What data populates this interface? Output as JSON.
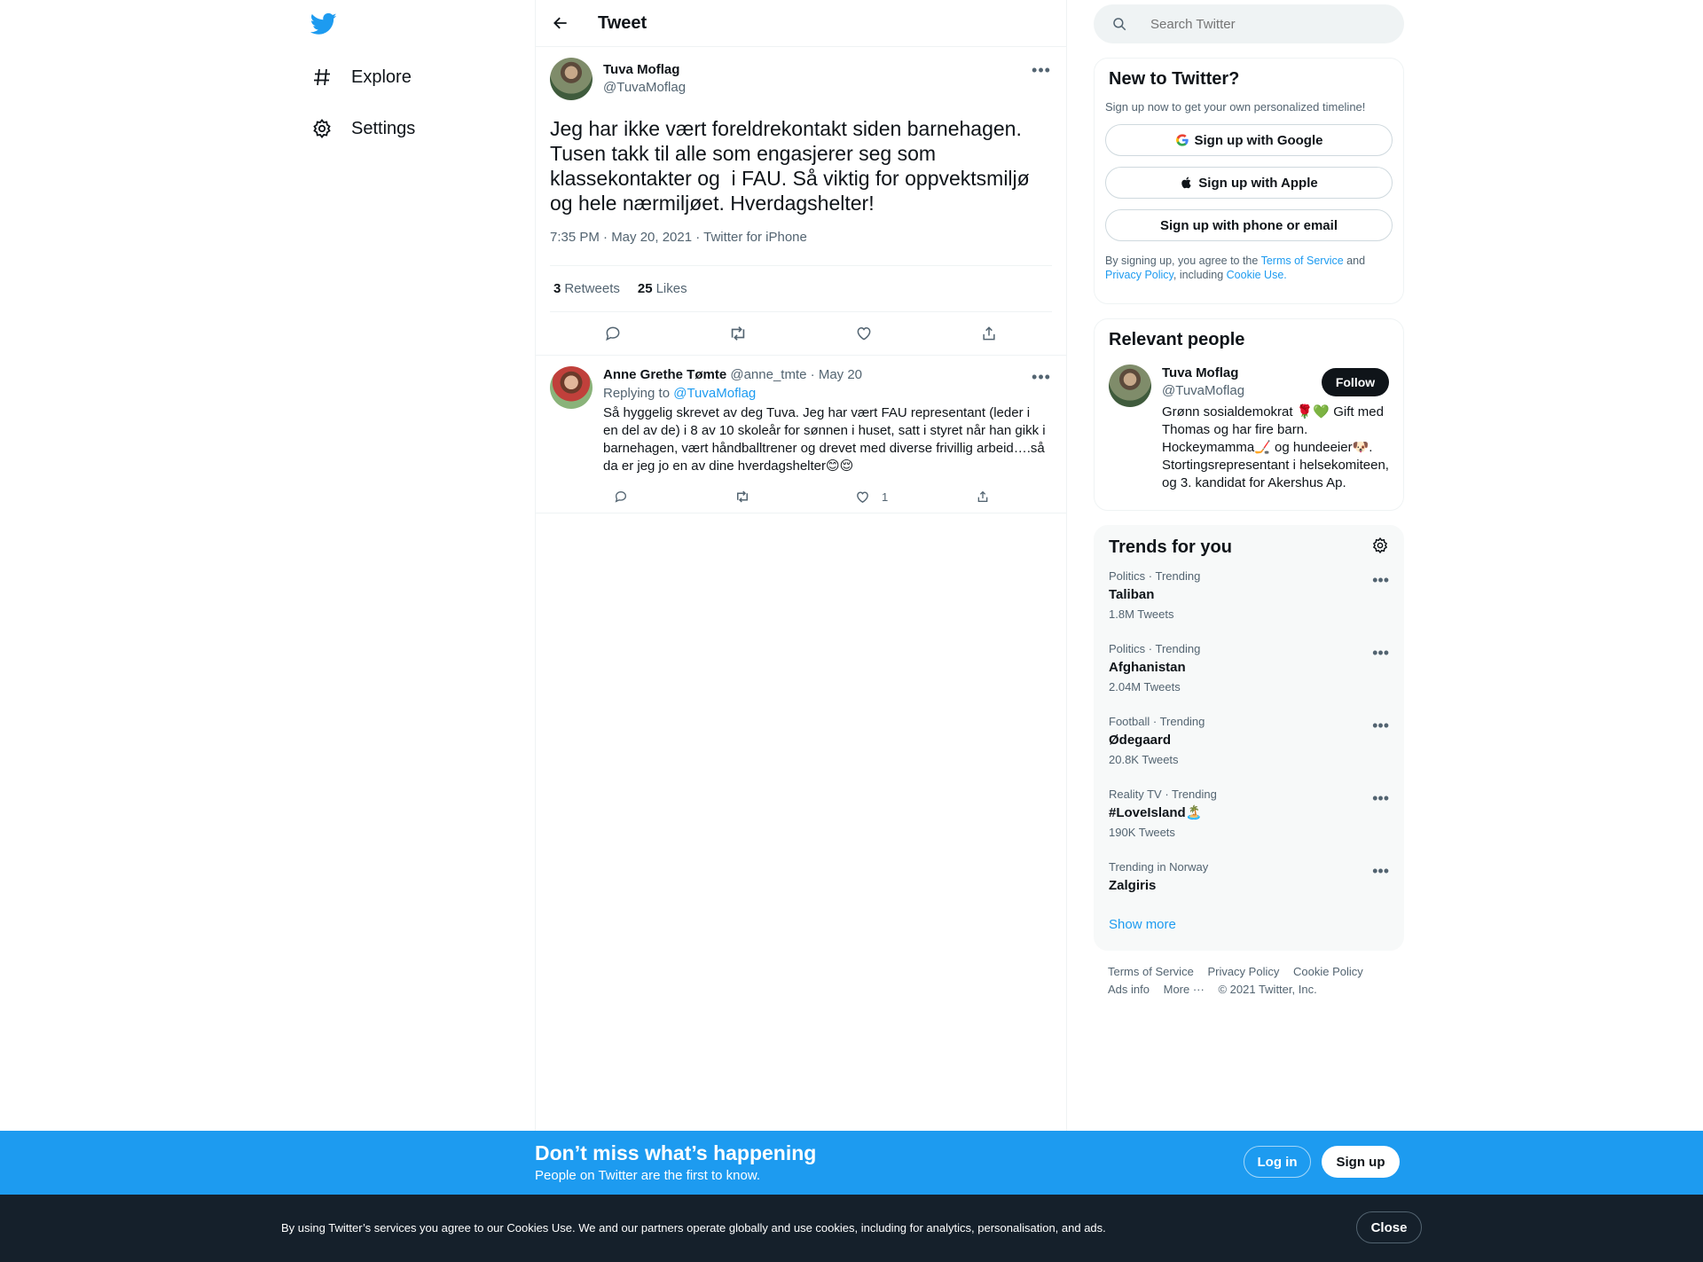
{
  "nav": {
    "logo": "twitter-bird",
    "items": [
      {
        "label": "Explore",
        "icon": "hashtag-icon"
      },
      {
        "label": "Settings",
        "icon": "gear-icon"
      }
    ]
  },
  "header": {
    "title": "Tweet"
  },
  "tweet": {
    "name": "Tuva Moflag",
    "handle": "@TuvaMoflag",
    "text": "Jeg har ikke vært foreldrekontakt siden barnehagen. Tusen takk til alle som engasjerer seg som klassekontakter og  i FAU. Så viktig for oppvektsmiljø og hele nærmiljøet. Hverdagshelter!",
    "meta": "7:35 PM · May 20, 2021 · Twitter for iPhone",
    "retweets": "3",
    "retweets_label": "Retweets",
    "likes": "25",
    "likes_label": "Likes"
  },
  "reply": {
    "name": "Anne Grethe Tømte",
    "handle": "@anne_tmte",
    "date": "· May 20",
    "replying_prefix": "Replying to",
    "replying_to": "@TuvaMoflag",
    "text": "Så hyggelig skrevet av deg Tuva. Jeg har vært FAU representant (leder i en del av de) i 8 av 10 skoleår for sønnen i huset, satt i styret når han gikk i barnehagen, vært håndballtrener og drevet med diverse frivillig arbeid….så da er jeg jo en av dine hverdagshelter😊😌",
    "likes": "1"
  },
  "search": {
    "placeholder": "Search Twitter"
  },
  "new_to_twitter": {
    "title": "New to Twitter?",
    "subtitle": "Sign up now to get your own personalized timeline!",
    "google": "Sign up with Google",
    "apple": "Sign up with Apple",
    "phone": "Sign up with phone or email",
    "legal_1": "By signing up, you agree to the",
    "terms": "Terms of Service",
    "legal_2": "and",
    "privacy": "Privacy Policy",
    "legal_3": ", including",
    "cookie": "Cookie Use."
  },
  "relevant": {
    "title": "Relevant people",
    "name": "Tuva Moflag",
    "handle": "@TuvaMoflag",
    "follow": "Follow",
    "bio": "Grønn sosialdemokrat 🌹💚 Gift med Thomas og har fire barn. Hockeymamma🏒 og hundeeier🐶. Stortingsrepresentant i helsekomiteen, og 3. kandidat for Akershus Ap."
  },
  "trends": {
    "title": "Trends for you",
    "items": [
      {
        "category": "Politics · Trending",
        "name": "Taliban",
        "count": "1.8M Tweets"
      },
      {
        "category": "Politics · Trending",
        "name": "Afghanistan",
        "count": "2.04M Tweets"
      },
      {
        "category": "Football · Trending",
        "name": "Ødegaard",
        "count": "20.8K Tweets"
      },
      {
        "category": "Reality TV · Trending",
        "name": "#LoveIsland🏝️",
        "count": "190K Tweets"
      },
      {
        "category": "Trending in Norway",
        "name": "Zalgiris",
        "count": ""
      }
    ],
    "show_more": "Show more"
  },
  "footer": {
    "terms": "Terms of Service",
    "privacy": "Privacy Policy",
    "cookie": "Cookie Policy",
    "ads": "Ads info",
    "more": "More ···",
    "copyright": "© 2021 Twitter, Inc."
  },
  "banner": {
    "title": "Don’t miss what’s happening",
    "subtitle": "People on Twitter are the first to know.",
    "login": "Log in",
    "signup": "Sign up"
  },
  "cookies": {
    "text": "By using Twitter’s services you agree to our Cookies Use. We and our partners operate globally and use cookies, including for analytics, personalisation, and ads.",
    "close": "Close"
  },
  "colors": {
    "accent": "#1d9bf0",
    "text": "#0f1419",
    "muted": "#536471",
    "cookie_bg": "#15202b"
  }
}
